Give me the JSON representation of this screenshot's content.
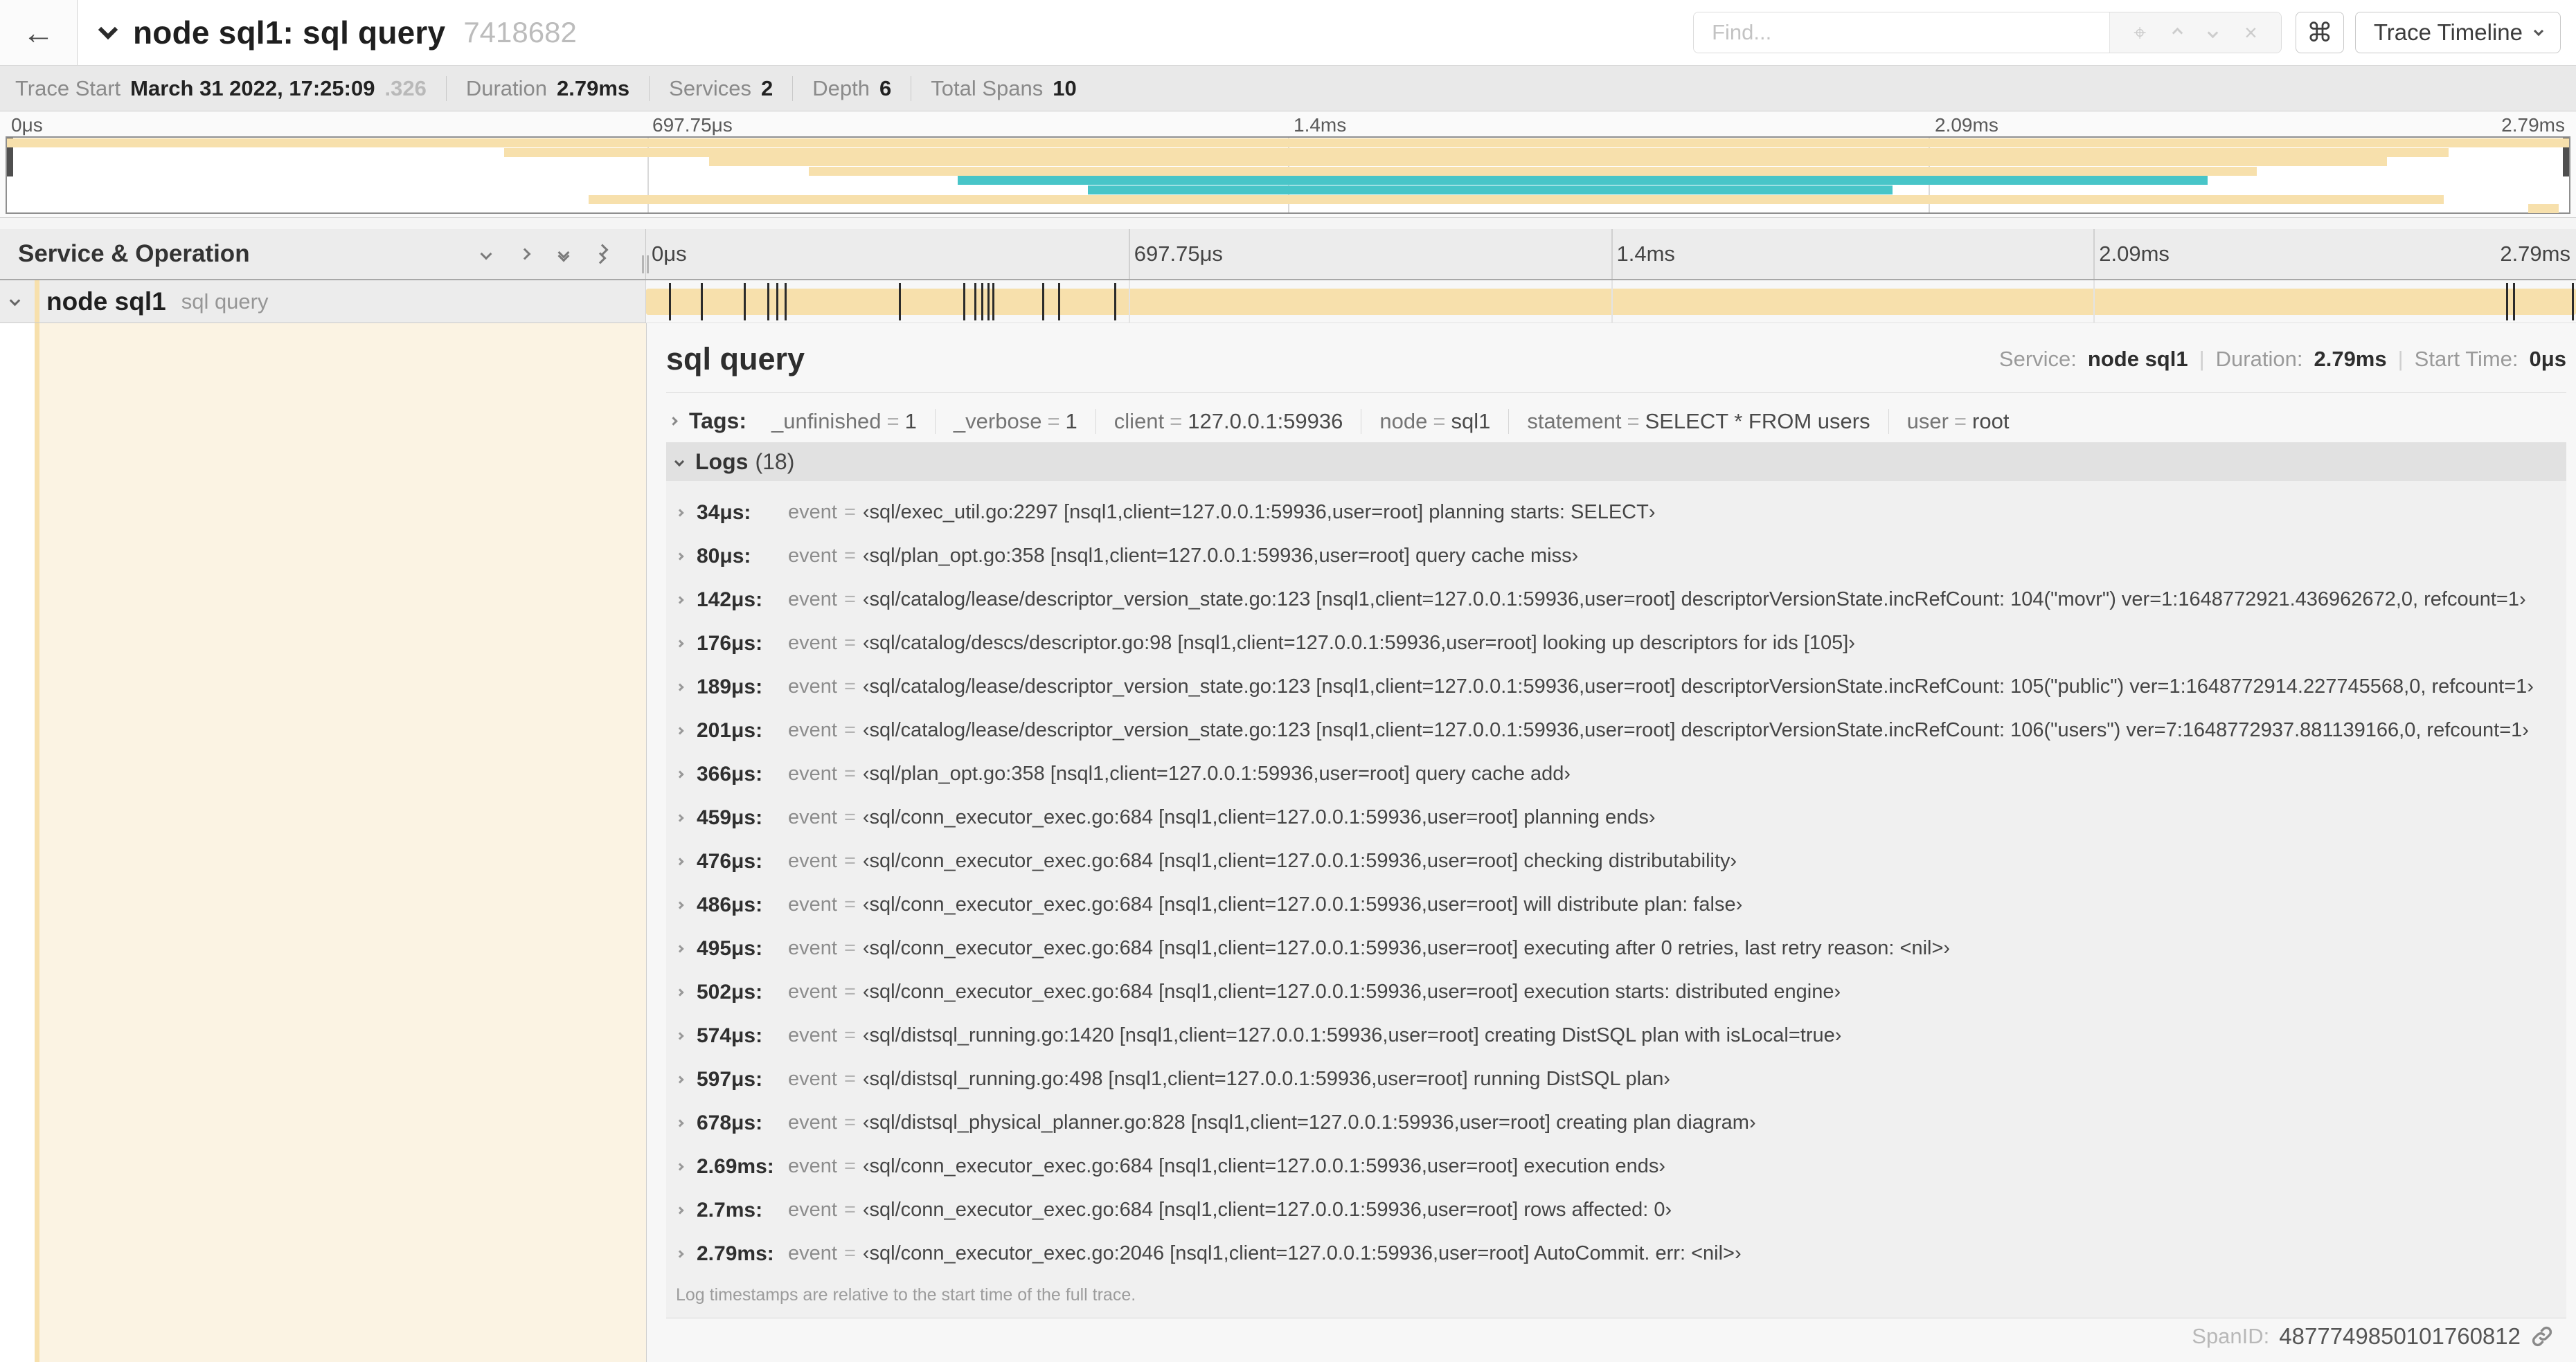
{
  "colors": {
    "tan": "#f7e0ac",
    "teal": "#48c5c8",
    "cream": "#fbf3e3",
    "tick": "#2b2b2b"
  },
  "header": {
    "back_icon": "arrow-left",
    "title": "node sql1: sql query",
    "trace_id": "7418682",
    "find_placeholder": "Find...",
    "find_icons": [
      "locate-icon",
      "chevron-up-icon",
      "chevron-down-icon",
      "clear-icon"
    ],
    "shortcut_label": "⌘",
    "view_label": "Trace Timeline"
  },
  "summary": {
    "items": [
      {
        "label": "Trace Start",
        "value": "March 31 2022, 17:25:09",
        "muted": ".326"
      },
      {
        "label": "Duration",
        "value": "2.79ms",
        "muted": ""
      },
      {
        "label": "Services",
        "value": "2",
        "muted": ""
      },
      {
        "label": "Depth",
        "value": "6",
        "muted": ""
      },
      {
        "label": "Total Spans",
        "value": "10",
        "muted": ""
      }
    ]
  },
  "axis_labels": [
    {
      "text": "0μs",
      "pos": 0
    },
    {
      "text": "697.75μs",
      "pos": 25
    },
    {
      "text": "1.4ms",
      "pos": 50
    },
    {
      "text": "2.09ms",
      "pos": 75
    },
    {
      "text": "2.79ms",
      "pos": 100
    }
  ],
  "minimap": {
    "bars": [
      {
        "row": 0,
        "left": 0,
        "width": 100,
        "color": "tan"
      },
      {
        "row": 1,
        "left": 19.4,
        "width": 75.9,
        "color": "tan"
      },
      {
        "row": 2,
        "left": 27.4,
        "width": 65.5,
        "color": "tan"
      },
      {
        "row": 3,
        "left": 31.3,
        "width": 56.5,
        "color": "tan"
      },
      {
        "row": 4,
        "left": 37.1,
        "width": 48.8,
        "color": "teal"
      },
      {
        "row": 5,
        "left": 42.2,
        "width": 31.4,
        "color": "teal"
      },
      {
        "row": 6,
        "left": 22.7,
        "width": 72.4,
        "color": "tan"
      },
      {
        "row": 7,
        "left": 98.4,
        "width": 1.2,
        "color": "tan"
      }
    ]
  },
  "timeline_header": {
    "title": "Service & Operation"
  },
  "span_row": {
    "service": "node sql1",
    "operation": "sql query",
    "duration_us": 2790,
    "tick_times_us": [
      34,
      80,
      142,
      176,
      189,
      201,
      366,
      459,
      476,
      486,
      495,
      502,
      574,
      597,
      678,
      2690,
      2700,
      2785
    ]
  },
  "detail": {
    "operation": "sql query",
    "service_label": "Service:",
    "service": "node sql1",
    "duration_label": "Duration:",
    "duration": "2.79ms",
    "start_label": "Start Time:",
    "start": "0μs",
    "tags_label": "Tags:",
    "tags": [
      {
        "key": "_unfinished",
        "value": "1"
      },
      {
        "key": "_verbose",
        "value": "1"
      },
      {
        "key": "client",
        "value": "127.0.0.1:59936"
      },
      {
        "key": "node",
        "value": "sql1"
      },
      {
        "key": "statement",
        "value": "SELECT * FROM users"
      },
      {
        "key": "user",
        "value": "root"
      }
    ],
    "logs_label": "Logs",
    "logs_count": "(18)",
    "log_key": "event",
    "logs": [
      {
        "time": "34μs:",
        "value": "‹sql/exec_util.go:2297 [nsql1,client=127.0.0.1:59936,user=root] planning starts: SELECT›"
      },
      {
        "time": "80μs:",
        "value": "‹sql/plan_opt.go:358 [nsql1,client=127.0.0.1:59936,user=root] query cache miss›"
      },
      {
        "time": "142μs:",
        "value": "‹sql/catalog/lease/descriptor_version_state.go:123 [nsql1,client=127.0.0.1:59936,user=root] descriptorVersionState.incRefCount: 104(\"movr\") ver=1:1648772921.436962672,0, refcount=1›"
      },
      {
        "time": "176μs:",
        "value": "‹sql/catalog/descs/descriptor.go:98 [nsql1,client=127.0.0.1:59936,user=root] looking up descriptors for ids [105]›"
      },
      {
        "time": "189μs:",
        "value": "‹sql/catalog/lease/descriptor_version_state.go:123 [nsql1,client=127.0.0.1:59936,user=root] descriptorVersionState.incRefCount: 105(\"public\") ver=1:1648772914.227745568,0, refcount=1›"
      },
      {
        "time": "201μs:",
        "value": "‹sql/catalog/lease/descriptor_version_state.go:123 [nsql1,client=127.0.0.1:59936,user=root] descriptorVersionState.incRefCount: 106(\"users\") ver=7:1648772937.881139166,0, refcount=1›"
      },
      {
        "time": "366μs:",
        "value": "‹sql/plan_opt.go:358 [nsql1,client=127.0.0.1:59936,user=root] query cache add›"
      },
      {
        "time": "459μs:",
        "value": "‹sql/conn_executor_exec.go:684 [nsql1,client=127.0.0.1:59936,user=root] planning ends›"
      },
      {
        "time": "476μs:",
        "value": "‹sql/conn_executor_exec.go:684 [nsql1,client=127.0.0.1:59936,user=root] checking distributability›"
      },
      {
        "time": "486μs:",
        "value": "‹sql/conn_executor_exec.go:684 [nsql1,client=127.0.0.1:59936,user=root] will distribute plan: false›"
      },
      {
        "time": "495μs:",
        "value": "‹sql/conn_executor_exec.go:684 [nsql1,client=127.0.0.1:59936,user=root] executing after 0 retries, last retry reason: <nil>›"
      },
      {
        "time": "502μs:",
        "value": "‹sql/conn_executor_exec.go:684 [nsql1,client=127.0.0.1:59936,user=root] execution starts: distributed engine›"
      },
      {
        "time": "574μs:",
        "value": "‹sql/distsql_running.go:1420 [nsql1,client=127.0.0.1:59936,user=root] creating DistSQL plan with isLocal=true›"
      },
      {
        "time": "597μs:",
        "value": "‹sql/distsql_running.go:498 [nsql1,client=127.0.0.1:59936,user=root] running DistSQL plan›"
      },
      {
        "time": "678μs:",
        "value": "‹sql/distsql_physical_planner.go:828 [nsql1,client=127.0.0.1:59936,user=root] creating plan diagram›"
      },
      {
        "time": "2.69ms:",
        "value": "‹sql/conn_executor_exec.go:684 [nsql1,client=127.0.0.1:59936,user=root] execution ends›"
      },
      {
        "time": "2.7ms:",
        "value": "‹sql/conn_executor_exec.go:684 [nsql1,client=127.0.0.1:59936,user=root] rows affected: 0›"
      },
      {
        "time": "2.79ms:",
        "value": "‹sql/conn_executor_exec.go:2046 [nsql1,client=127.0.0.1:59936,user=root] AutoCommit. err: <nil>›"
      }
    ],
    "footer_note": "Log timestamps are relative to the start time of the full trace.",
    "spanid_label": "SpanID:",
    "spanid": "4877749850101760812"
  }
}
